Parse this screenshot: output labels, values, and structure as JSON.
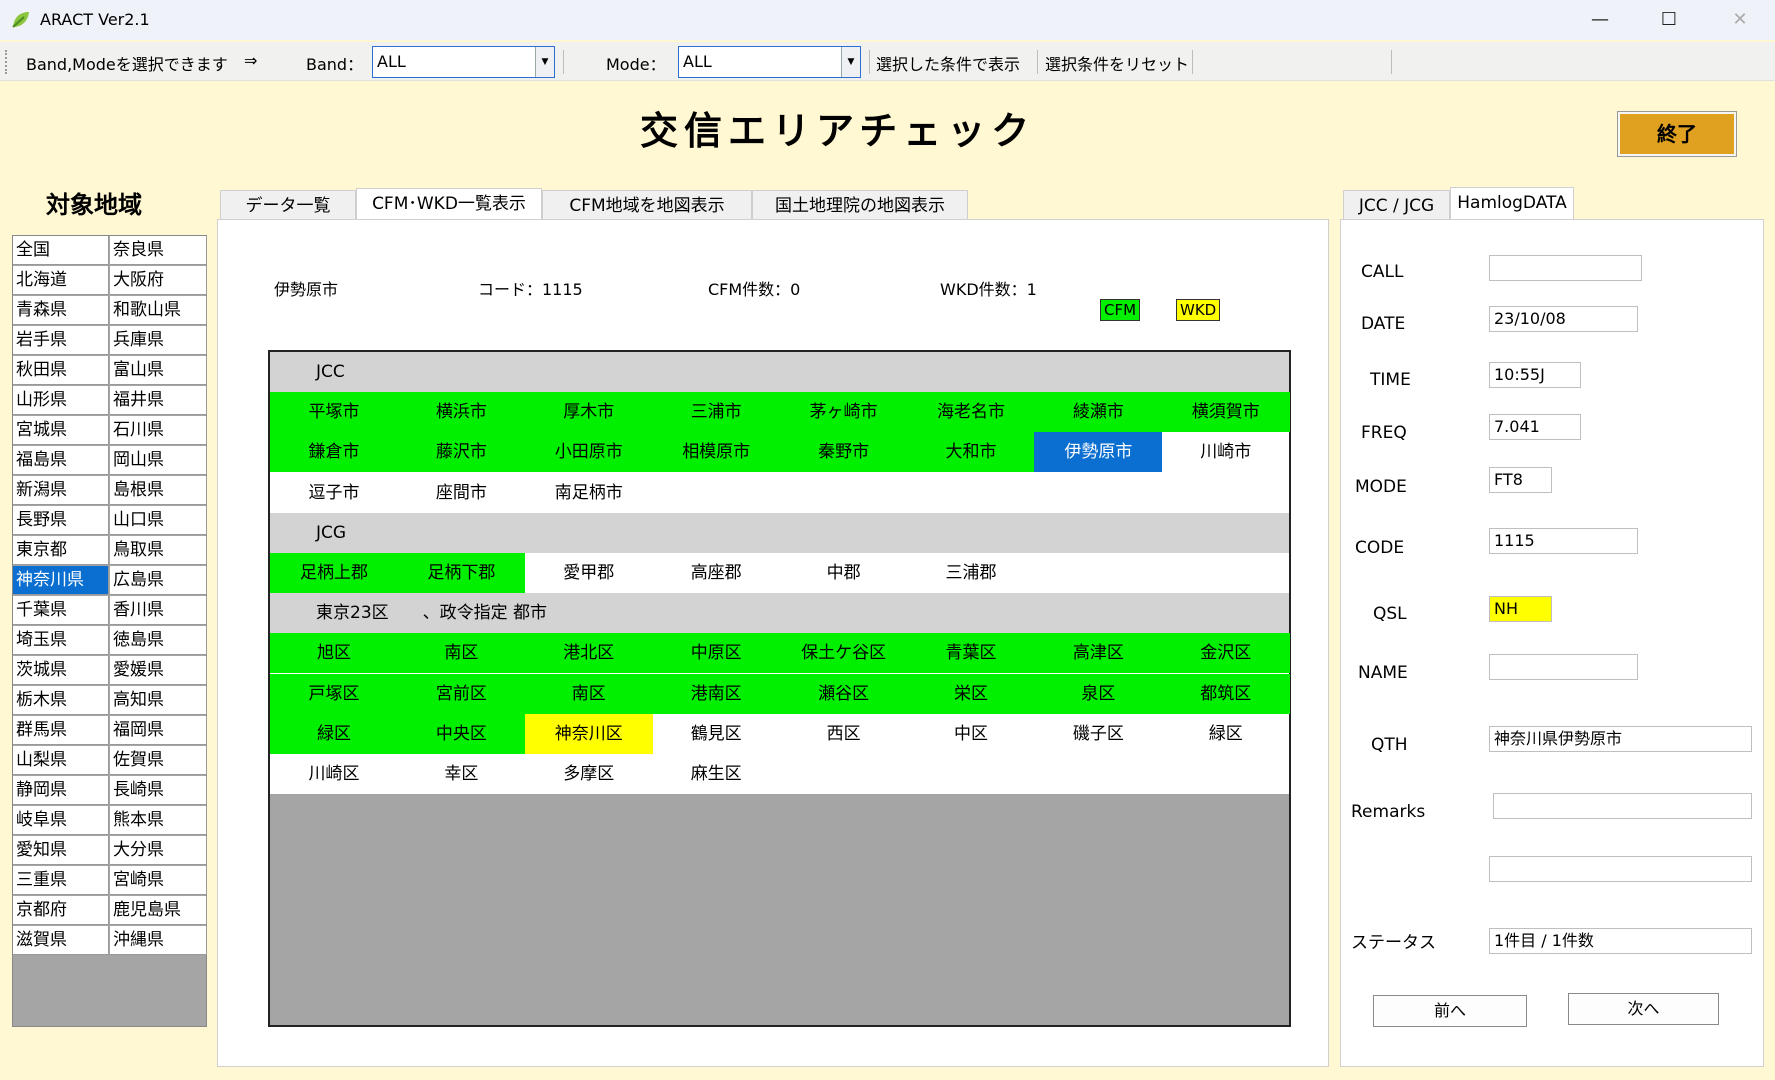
{
  "window": {
    "title": "ARACT Ver2.1"
  },
  "toolbar": {
    "hint": "Band,Modeを選択できます",
    "arrow": "⇒",
    "band_label": "Band：",
    "band_value": "ALL",
    "mode_label": "Mode：",
    "mode_value": "ALL",
    "show_button": "選択した条件で表示",
    "reset_button": "選択条件をリセット"
  },
  "page": {
    "title": "交信エリアチェック",
    "exit_button": "終了"
  },
  "region": {
    "label": "対象地域",
    "items": [
      "全国",
      "奈良県",
      "北海道",
      "大阪府",
      "青森県",
      "和歌山県",
      "岩手県",
      "兵庫県",
      "秋田県",
      "富山県",
      "山形県",
      "福井県",
      "宮城県",
      "石川県",
      "福島県",
      "岡山県",
      "新潟県",
      "島根県",
      "長野県",
      "山口県",
      "東京都",
      "鳥取県",
      "神奈川県",
      "広島県",
      "千葉県",
      "香川県",
      "埼玉県",
      "徳島県",
      "茨城県",
      "愛媛県",
      "栃木県",
      "高知県",
      "群馬県",
      "福岡県",
      "山梨県",
      "佐賀県",
      "静岡県",
      "長崎県",
      "岐阜県",
      "熊本県",
      "愛知県",
      "大分県",
      "三重県",
      "宮崎県",
      "京都府",
      "鹿児島県",
      "滋賀県",
      "沖縄県"
    ],
    "selected": "神奈川県"
  },
  "tabs": [
    "データ一覧",
    "CFM･WKD一覧表示",
    "CFM地域を地図表示",
    "国土地理院の地図表示"
  ],
  "info": {
    "city": "伊勢原市",
    "code": "コード：1115",
    "cfm": "CFM件数：0",
    "wkd": "WKD件数：1"
  },
  "legend": {
    "cfm": "CFM",
    "wkd": "WKD"
  },
  "colors": {
    "cfm": "#00f000",
    "wkd": "#ffff00",
    "selected": "#0a6fd1"
  },
  "areas": {
    "jcc_header": "JCC",
    "jcc": [
      {
        "name": "平塚市",
        "status": "cfm"
      },
      {
        "name": "横浜市",
        "status": "cfm"
      },
      {
        "name": "厚木市",
        "status": "cfm"
      },
      {
        "name": "三浦市",
        "status": "cfm"
      },
      {
        "name": "茅ヶ崎市",
        "status": "cfm"
      },
      {
        "name": "海老名市",
        "status": "cfm"
      },
      {
        "name": "綾瀬市",
        "status": "cfm"
      },
      {
        "name": "横須賀市",
        "status": "cfm"
      },
      {
        "name": "鎌倉市",
        "status": "cfm"
      },
      {
        "name": "藤沢市",
        "status": "cfm"
      },
      {
        "name": "小田原市",
        "status": "cfm"
      },
      {
        "name": "相模原市",
        "status": "cfm"
      },
      {
        "name": "秦野市",
        "status": "cfm"
      },
      {
        "name": "大和市",
        "status": "cfm"
      },
      {
        "name": "伊勢原市",
        "status": "selected"
      },
      {
        "name": "川崎市",
        "status": "none"
      },
      {
        "name": "逗子市",
        "status": "none"
      },
      {
        "name": "座間市",
        "status": "none"
      },
      {
        "name": "南足柄市",
        "status": "none"
      }
    ],
    "jcg_header": "JCG",
    "jcg": [
      {
        "name": "足柄上郡",
        "status": "cfm"
      },
      {
        "name": "足柄下郡",
        "status": "cfm"
      },
      {
        "name": "愛甲郡",
        "status": "none"
      },
      {
        "name": "高座郡",
        "status": "none"
      },
      {
        "name": "中郡",
        "status": "none"
      },
      {
        "name": "三浦郡",
        "status": "none"
      }
    ],
    "ward_header": "東京23区　　、政令指定 都市",
    "wards": [
      {
        "name": "旭区",
        "status": "cfm"
      },
      {
        "name": "南区",
        "status": "cfm"
      },
      {
        "name": "港北区",
        "status": "cfm"
      },
      {
        "name": "中原区",
        "status": "cfm"
      },
      {
        "name": "保土ケ谷区",
        "status": "cfm"
      },
      {
        "name": "青葉区",
        "status": "cfm"
      },
      {
        "name": "高津区",
        "status": "cfm"
      },
      {
        "name": "金沢区",
        "status": "cfm"
      },
      {
        "name": "戸塚区",
        "status": "cfm"
      },
      {
        "name": "宮前区",
        "status": "cfm"
      },
      {
        "name": "南区",
        "status": "cfm"
      },
      {
        "name": "港南区",
        "status": "cfm"
      },
      {
        "name": "瀬谷区",
        "status": "cfm"
      },
      {
        "name": "栄区",
        "status": "cfm"
      },
      {
        "name": "泉区",
        "status": "cfm"
      },
      {
        "name": "都筑区",
        "status": "cfm"
      },
      {
        "name": "緑区",
        "status": "cfm"
      },
      {
        "name": "中央区",
        "status": "cfm"
      },
      {
        "name": "神奈川区",
        "status": "wkd"
      },
      {
        "name": "鶴見区",
        "status": "none"
      },
      {
        "name": "西区",
        "status": "none"
      },
      {
        "name": "中区",
        "status": "none"
      },
      {
        "name": "磯子区",
        "status": "none"
      },
      {
        "name": "緑区",
        "status": "none"
      },
      {
        "name": "川崎区",
        "status": "none"
      },
      {
        "name": "幸区",
        "status": "none"
      },
      {
        "name": "多摩区",
        "status": "none"
      },
      {
        "name": "麻生区",
        "status": "none"
      }
    ]
  },
  "right": {
    "tabs": [
      "JCC / JCG",
      "HamlogDATA"
    ],
    "fields": {
      "call": {
        "label": "CALL",
        "value": ""
      },
      "date": {
        "label": "DATE",
        "value": "23/10/08"
      },
      "time": {
        "label": "TIME",
        "value": "10:55J"
      },
      "freq": {
        "label": "FREQ",
        "value": "7.041"
      },
      "mode": {
        "label": "MODE",
        "value": "FT8"
      },
      "code": {
        "label": "CODE",
        "value": "1115"
      },
      "qsl": {
        "label": "QSL",
        "value": "NH"
      },
      "name": {
        "label": "NAME",
        "value": ""
      },
      "qth": {
        "label": "QTH",
        "value": "神奈川県伊勢原市"
      },
      "remarks": {
        "label": "Remarks",
        "value": "",
        "value2": ""
      },
      "status": {
        "label": "ステータス",
        "value": "1件目 / 1件数"
      }
    },
    "prev_button": "前へ",
    "next_button": "次へ"
  }
}
